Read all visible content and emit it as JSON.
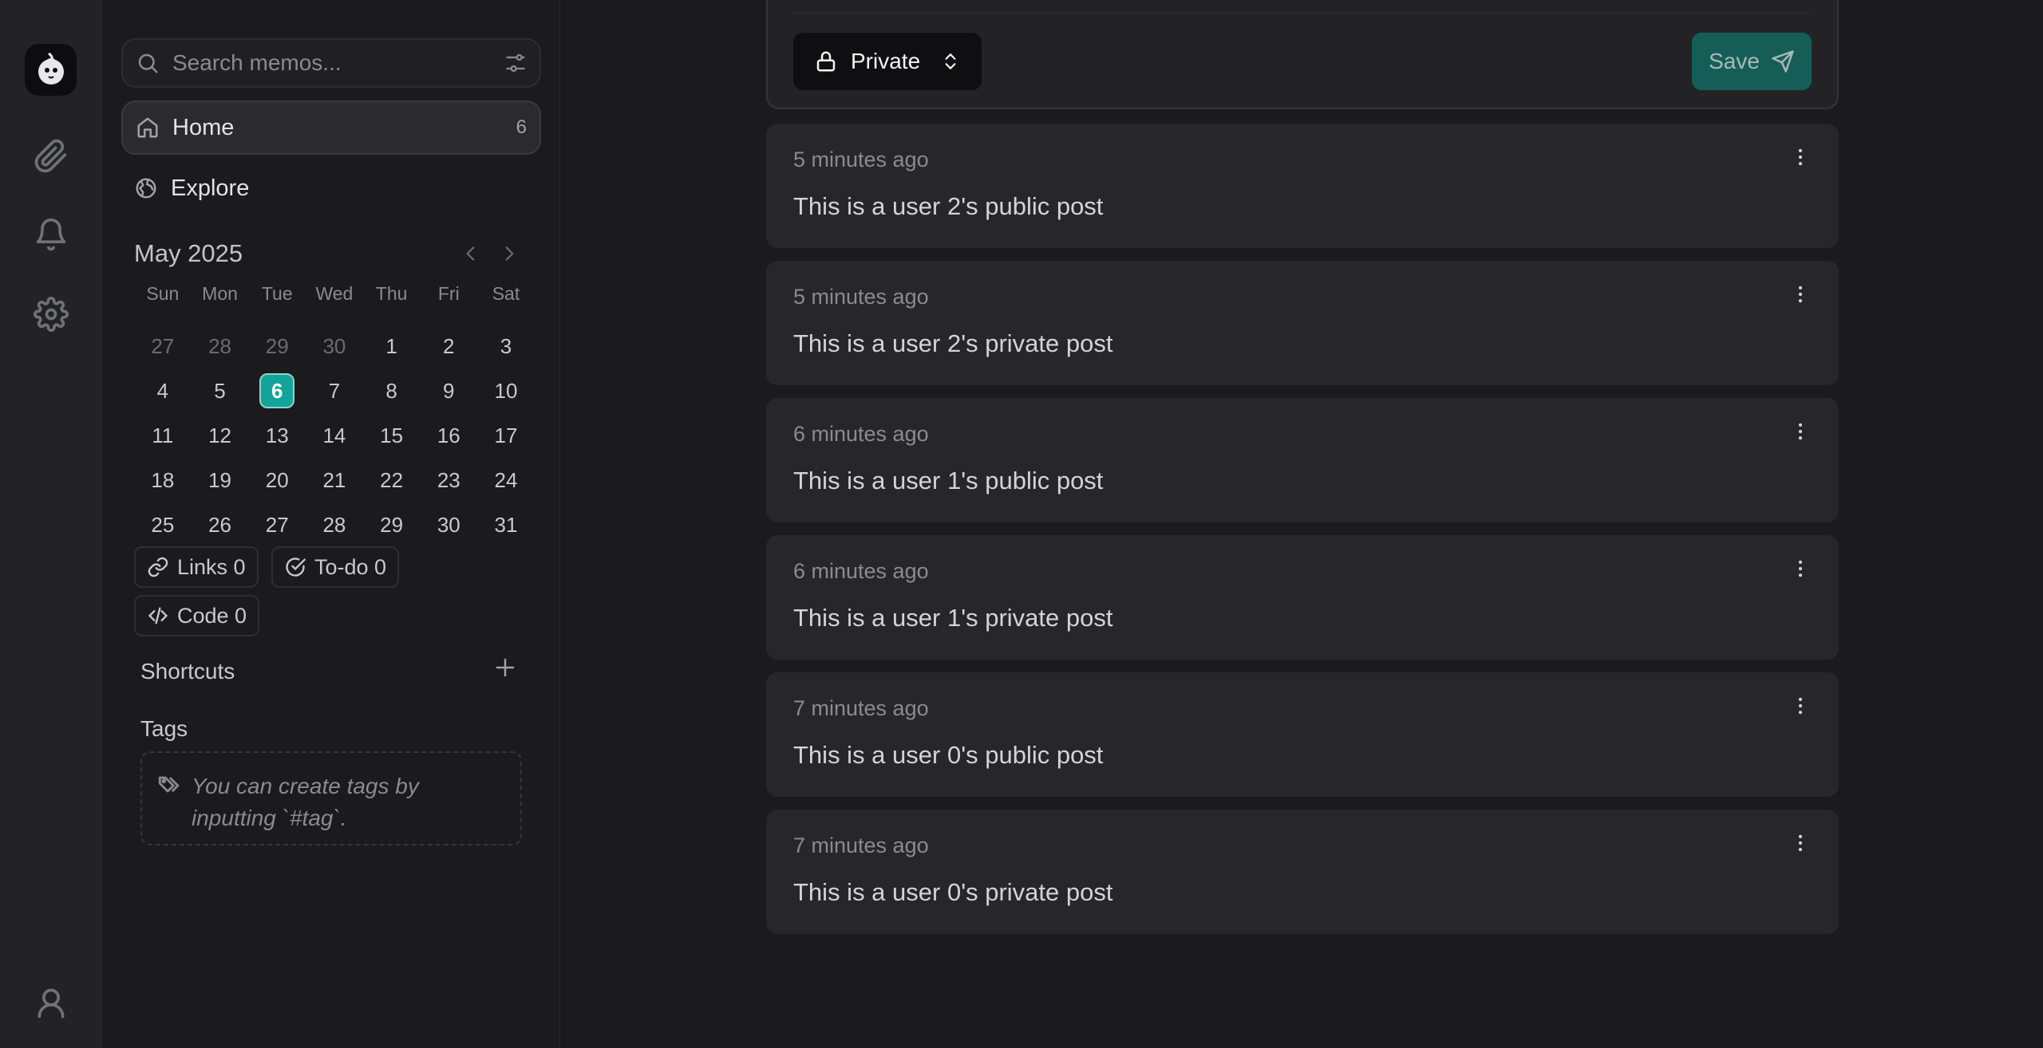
{
  "search": {
    "placeholder": "Search memos..."
  },
  "nav": {
    "home": {
      "label": "Home",
      "count": "6"
    },
    "explore": {
      "label": "Explore"
    }
  },
  "calendar": {
    "title": "May 2025",
    "weekdays": [
      "Sun",
      "Mon",
      "Tue",
      "Wed",
      "Thu",
      "Fri",
      "Sat"
    ],
    "weeks": [
      [
        "27",
        "28",
        "29",
        "30",
        "1",
        "2",
        "3"
      ],
      [
        "4",
        "5",
        "6",
        "7",
        "8",
        "9",
        "10"
      ],
      [
        "11",
        "12",
        "13",
        "14",
        "15",
        "16",
        "17"
      ],
      [
        "18",
        "19",
        "20",
        "21",
        "22",
        "23",
        "24"
      ],
      [
        "25",
        "26",
        "27",
        "28",
        "29",
        "30",
        "31"
      ]
    ],
    "today": "6"
  },
  "stats": {
    "links": "Links 0",
    "todo": "To-do 0",
    "code": "Code 0"
  },
  "shortcuts": {
    "title": "Shortcuts"
  },
  "tags": {
    "title": "Tags",
    "hint_line1": "You can create tags by",
    "hint_line2": "inputting `#tag`."
  },
  "editor": {
    "visibility": "Private",
    "save_label": "Save"
  },
  "memos": [
    {
      "time": "5 minutes ago",
      "content": "This is a user 2's public post"
    },
    {
      "time": "5 minutes ago",
      "content": "This is a user 2's private post"
    },
    {
      "time": "6 minutes ago",
      "content": "This is a user 1's public post"
    },
    {
      "time": "6 minutes ago",
      "content": "This is a user 1's private post"
    },
    {
      "time": "7 minutes ago",
      "content": "This is a user 0's public post"
    },
    {
      "time": "7 minutes ago",
      "content": "This is a user 0's private post"
    }
  ],
  "colors": {
    "accent": "#14a39a",
    "save_button": "#155e58",
    "background": "#1b1b1d",
    "card": "#27272a"
  },
  "icons": {
    "rail": [
      "app-logo",
      "paperclip-icon",
      "bell-icon",
      "gear-icon",
      "user-icon"
    ]
  }
}
